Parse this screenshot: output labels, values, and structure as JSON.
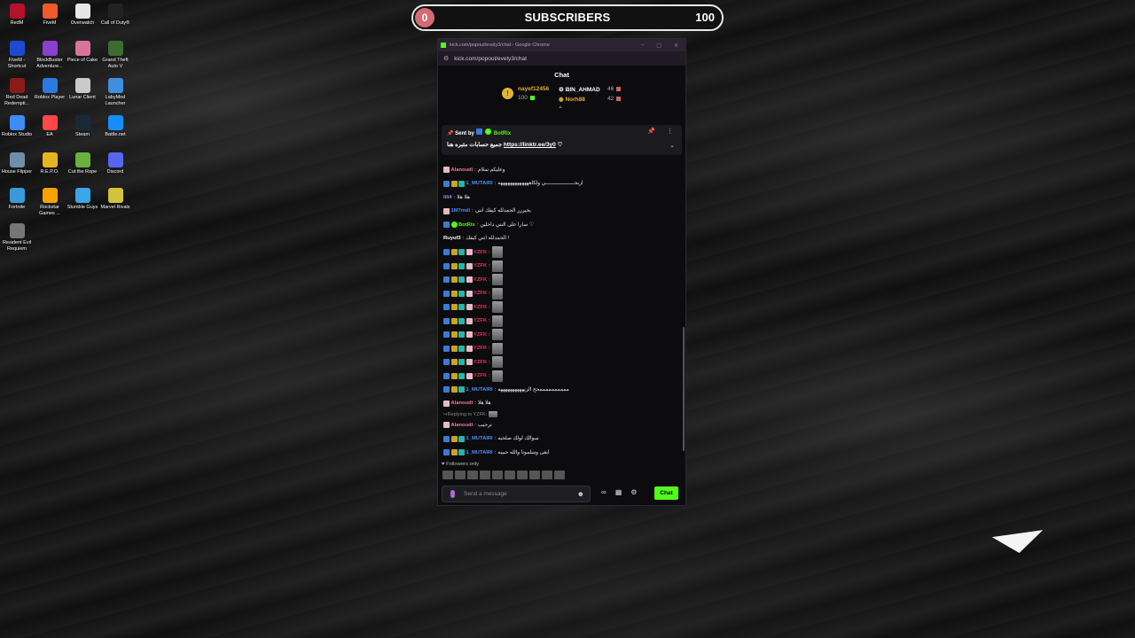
{
  "desktop_icons": [
    {
      "label": "RedM",
      "color": "#b3122a",
      "icon": "redm-icon"
    },
    {
      "label": "FiveM",
      "color": "#f05a28",
      "icon": "fivem-icon"
    },
    {
      "label": "Overwatch",
      "color": "#e6e6e6",
      "icon": "overwatch-icon"
    },
    {
      "label": "Call of Duty®",
      "color": "#222",
      "icon": "cod-icon"
    },
    {
      "label": "FiveM - Shortcut",
      "color": "#1c4bd1",
      "icon": "fivem-shortcut-icon"
    },
    {
      "label": "BlockBuster Adventure...",
      "color": "#8a3fd0",
      "icon": "blockbuster-icon"
    },
    {
      "label": "Piece of Cake",
      "color": "#d8749c",
      "icon": "piece-of-cake-icon"
    },
    {
      "label": "Grand Theft Auto V",
      "color": "#3e6b2f",
      "icon": "gta-icon"
    },
    {
      "label": "Red Dead Redempti...",
      "color": "#8d1a1a",
      "icon": "rdr-icon"
    },
    {
      "label": "Roblox Player",
      "color": "#2a7ae2",
      "icon": "roblox-icon"
    },
    {
      "label": "Lunar Client",
      "color": "#c9c9c9",
      "icon": "lunar-icon"
    },
    {
      "label": "LabyMod Launcher",
      "color": "#3f8fe0",
      "icon": "labymod-icon"
    },
    {
      "label": "Roblox Studio",
      "color": "#3d8df5",
      "icon": "roblox-studio-icon"
    },
    {
      "label": "EA",
      "color": "#ff4747",
      "icon": "ea-icon"
    },
    {
      "label": "Steam",
      "color": "#1b2838",
      "icon": "steam-icon"
    },
    {
      "label": "Battle.net",
      "color": "#148eff",
      "icon": "battlenet-icon"
    },
    {
      "label": "House Flipper",
      "color": "#6f8fa8",
      "icon": "house-flipper-icon"
    },
    {
      "label": "R.E.P.O.",
      "color": "#e8b321",
      "icon": "repo-icon"
    },
    {
      "label": "Cut the Rope",
      "color": "#6bb13d",
      "icon": "cut-the-rope-icon"
    },
    {
      "label": "Discord",
      "color": "#5865f2",
      "icon": "discord-icon"
    },
    {
      "label": "Fortnite",
      "color": "#3a9ad9",
      "icon": "fortnite-icon"
    },
    {
      "label": "Rockstar Games ...",
      "color": "#f7a400",
      "icon": "rockstar-icon"
    },
    {
      "label": "Stumble Guys",
      "color": "#39a6e8",
      "icon": "stumble-guys-icon"
    },
    {
      "label": "Marvel Rivals",
      "color": "#d3c23a",
      "icon": "marvel-rivals-icon"
    },
    {
      "label": "Resident Evil Requiem",
      "color": "#777",
      "icon": "resident-evil-icon"
    }
  ],
  "subscribers": {
    "current": "0",
    "label": "SUBSCRIBERS",
    "goal": "100",
    "progress": 0
  },
  "window": {
    "title": "kick.com/popout/evely3/chat - Google Chrome",
    "url": "kick.com/popout/evely3/chat",
    "chat_heading": "Chat"
  },
  "leaderboard": {
    "first": {
      "name": "nayef12456",
      "amount": "100"
    },
    "second": {
      "name": "BIN_AHMAD",
      "amount": "46"
    },
    "third": {
      "name": "Norh88",
      "amount": "42"
    }
  },
  "pinned": {
    "sent_by": "Sent by",
    "bot": "BotRix",
    "message": "جميع حسابات مثبره هنا",
    "link": "https://linktr.ee/3y0"
  },
  "messages": [
    {
      "badges": [
        "b-pink"
      ],
      "user": "Alanoudi",
      "cls": "u-pink",
      "text": "وعليكم سلام"
    },
    {
      "badges": [
        "b-blue",
        "b-gold",
        "b-teal"
      ],
      "user": "1_MUTAIRI",
      "cls": "u-blue",
      "text": "اربحـــــــــــــــــــي ولكاهههههههههههههه"
    },
    {
      "badges": [],
      "user": "lili4",
      "cls": "u-purple",
      "text": "هلا هلا"
    },
    {
      "badges": [
        "b-pink"
      ],
      "user": "1M7mdi",
      "cls": "u-blue",
      "text": "بخيررر الحمدلله كيفك انتي"
    },
    {
      "badges": [
        "b-blue",
        "b-green"
      ],
      "user": "BotRix",
      "cls": "u-green",
      "text": "سارا على النتي داخلين ♡"
    },
    {
      "badges": [],
      "user": "Ruyuf3",
      "cls": "u-white",
      "text": "الحمدلله انتي كيفك !"
    },
    {
      "badges": [
        "b-blue",
        "b-gold",
        "b-teal",
        "b-pink"
      ],
      "user": "YZFK",
      "cls": "u-red",
      "text": "",
      "emote": true
    },
    {
      "badges": [
        "b-blue",
        "b-gold",
        "b-teal",
        "b-pink"
      ],
      "user": "YZFK",
      "cls": "u-red",
      "text": "",
      "emote": true
    },
    {
      "badges": [
        "b-blue",
        "b-gold",
        "b-teal",
        "b-pink"
      ],
      "user": "YZFK",
      "cls": "u-red",
      "text": "",
      "emote": true
    },
    {
      "badges": [
        "b-blue",
        "b-gold",
        "b-teal",
        "b-pink"
      ],
      "user": "YZFK",
      "cls": "u-red",
      "text": "",
      "emote": true
    },
    {
      "badges": [
        "b-blue",
        "b-gold",
        "b-teal",
        "b-pink"
      ],
      "user": "YZFK",
      "cls": "u-red",
      "text": "",
      "emote": true
    },
    {
      "badges": [
        "b-blue",
        "b-gold",
        "b-teal",
        "b-pink"
      ],
      "user": "YZFK",
      "cls": "u-red",
      "text": "",
      "emote": true
    },
    {
      "badges": [
        "b-blue",
        "b-gold",
        "b-teal",
        "b-pink"
      ],
      "user": "YZFK",
      "cls": "u-red",
      "text": "",
      "emote": true
    },
    {
      "badges": [
        "b-blue",
        "b-gold",
        "b-teal",
        "b-pink"
      ],
      "user": "YZFK",
      "cls": "u-red",
      "text": "",
      "emote": true
    },
    {
      "badges": [
        "b-blue",
        "b-gold",
        "b-teal",
        "b-pink"
      ],
      "user": "YZFK",
      "cls": "u-red",
      "text": "",
      "emote": true
    },
    {
      "badges": [
        "b-blue",
        "b-gold",
        "b-teal",
        "b-pink"
      ],
      "user": "YZFK",
      "cls": "u-red",
      "text": "",
      "emote": true
    },
    {
      "badges": [
        "b-blue",
        "b-gold",
        "b-teal"
      ],
      "user": "1_MUTAIRI",
      "cls": "u-blue",
      "text": "ممممممممممحح الزيههههههههههه"
    },
    {
      "badges": [
        "b-pink"
      ],
      "user": "Alanoudi",
      "cls": "u-pink",
      "text": "هلا هلا"
    },
    {
      "reply": "Replying to YZFK:"
    },
    {
      "badges": [
        "b-pink"
      ],
      "user": "Alanoudi",
      "cls": "u-pink",
      "text": "ترحيب"
    },
    {
      "badges": [
        "b-blue",
        "b-gold",
        "b-teal"
      ],
      "user": "1_MUTAIRI",
      "cls": "u-blue",
      "text": "سوالك لولك صلحيه"
    },
    {
      "badges": [
        "b-blue",
        "b-gold",
        "b-teal"
      ],
      "user": "1_MUTAIRI",
      "cls": "u-blue",
      "text": "ابغى وسلمونا والله حبيبه"
    }
  ],
  "footer": {
    "followers_only": "Followers only",
    "placeholder": "Send a message",
    "chat_button": "Chat"
  }
}
